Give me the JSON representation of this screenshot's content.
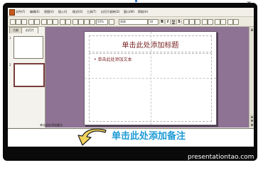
{
  "menubar": {
    "items": [
      "文件(F)",
      "编辑(E)",
      "视图(V)",
      "插入(I)",
      "格式(O)",
      "工具(T)",
      "幻灯片放映(D)",
      "窗口(W)",
      "帮助(H)"
    ]
  },
  "toolbar": {
    "zoom": "50%",
    "font": "宋体",
    "size": "18",
    "format_buttons": [
      "B",
      "I",
      "U",
      "S"
    ]
  },
  "sidepanel": {
    "tabs": [
      "大纲",
      "幻灯片"
    ],
    "thumb_numbers": [
      "1",
      "2"
    ]
  },
  "slide": {
    "title": "单击此处添加标题",
    "bullet": "• 单击此处添加文本"
  },
  "notes": {
    "placeholder": "单击此处添加备注",
    "callout": "单击此处添加备注"
  },
  "watermark": "presentationtao.com",
  "colors": {
    "workarea": "#8e7394",
    "title_text": "#7a2323",
    "callout": "#1d9ad6",
    "arrow_fill": "#f2d35a"
  }
}
